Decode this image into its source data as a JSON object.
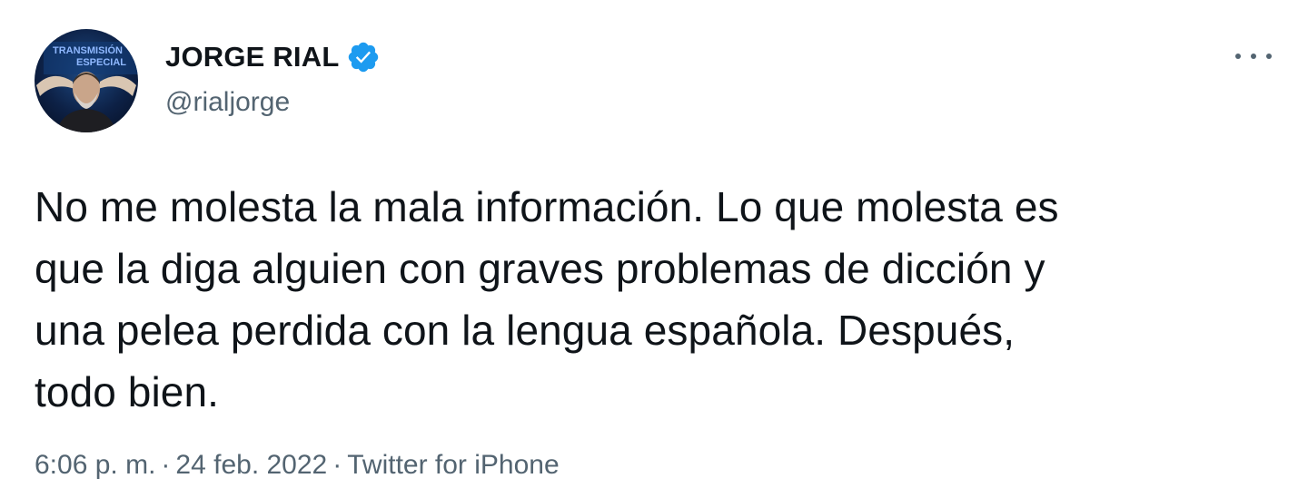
{
  "author": {
    "display_name": "JORGE RIAL",
    "handle": "@rialjorge",
    "verified": true,
    "avatar_overlay_text": [
      "TRANSMISIÓN",
      "ESPECIAL"
    ]
  },
  "tweet": {
    "text": "No me molesta la mala información. Lo que molesta es que la diga alguien con graves problemas de dicción y una pelea perdida con la lengua española. Después, todo bien.",
    "lines": [
      "No me molesta la mala información. Lo que molesta es",
      "que la diga alguien con graves problemas de dicción y",
      "una pelea perdida con la lengua española. Después,",
      "todo bien."
    ]
  },
  "meta": {
    "time": "6:06 p. m.",
    "separator": "·",
    "date": "24 feb. 2022",
    "source": "Twitter for iPhone"
  },
  "icons": {
    "verified": "verified-badge-icon",
    "more": "more-options-icon"
  },
  "colors": {
    "verified_blue": "#1d9bf0",
    "text_primary": "#0f1419",
    "text_secondary": "#536471",
    "background": "#ffffff"
  }
}
